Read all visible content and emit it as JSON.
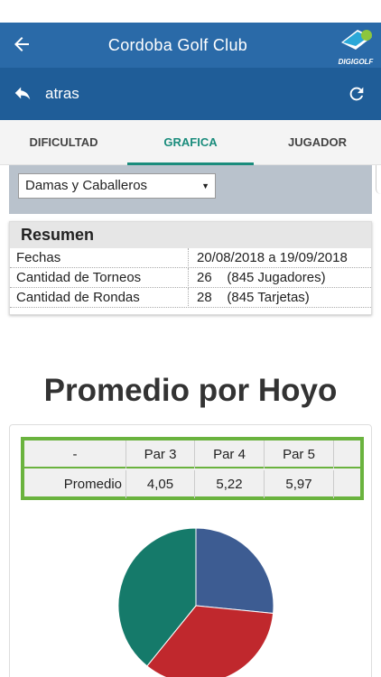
{
  "app": {
    "title": "Cordoba Golf Club",
    "logo_text": "DIGIGOLF",
    "brand_color": "#2a6aa8",
    "icons": [
      "arrow-left-icon",
      "reply-icon",
      "refresh-icon"
    ]
  },
  "subbar": {
    "back_label": "atras"
  },
  "tabs": [
    {
      "label": "DIFICULTAD",
      "active": false
    },
    {
      "label": "GRAFICA",
      "active": true
    },
    {
      "label": "JUGADOR",
      "active": false
    }
  ],
  "filter": {
    "selected": "Damas y Caballeros"
  },
  "resumen": {
    "title": "Resumen",
    "rows": [
      {
        "label": "Fechas",
        "value": "20/08/2018 a 19/09/2018"
      },
      {
        "label": "Cantidad de Torneos",
        "value": "26    (845 Jugadores)"
      },
      {
        "label": "Cantidad de Rondas",
        "value": "28    (845 Tarjetas)"
      }
    ]
  },
  "section_title": "Promedio por Hoyo",
  "promedio_table": {
    "headers": [
      "-",
      "Par 3",
      "Par 4",
      "Par 5",
      ""
    ],
    "row": [
      "Promedio",
      "4,05",
      "5,22",
      "5,97",
      ""
    ]
  },
  "chart_data": {
    "type": "pie",
    "categories": [
      "Par 3",
      "Par 4",
      "Par 5"
    ],
    "values": [
      4.05,
      5.22,
      5.97
    ],
    "colors": [
      "#3d5c92",
      "#c0282d",
      "#157a6a"
    ]
  }
}
